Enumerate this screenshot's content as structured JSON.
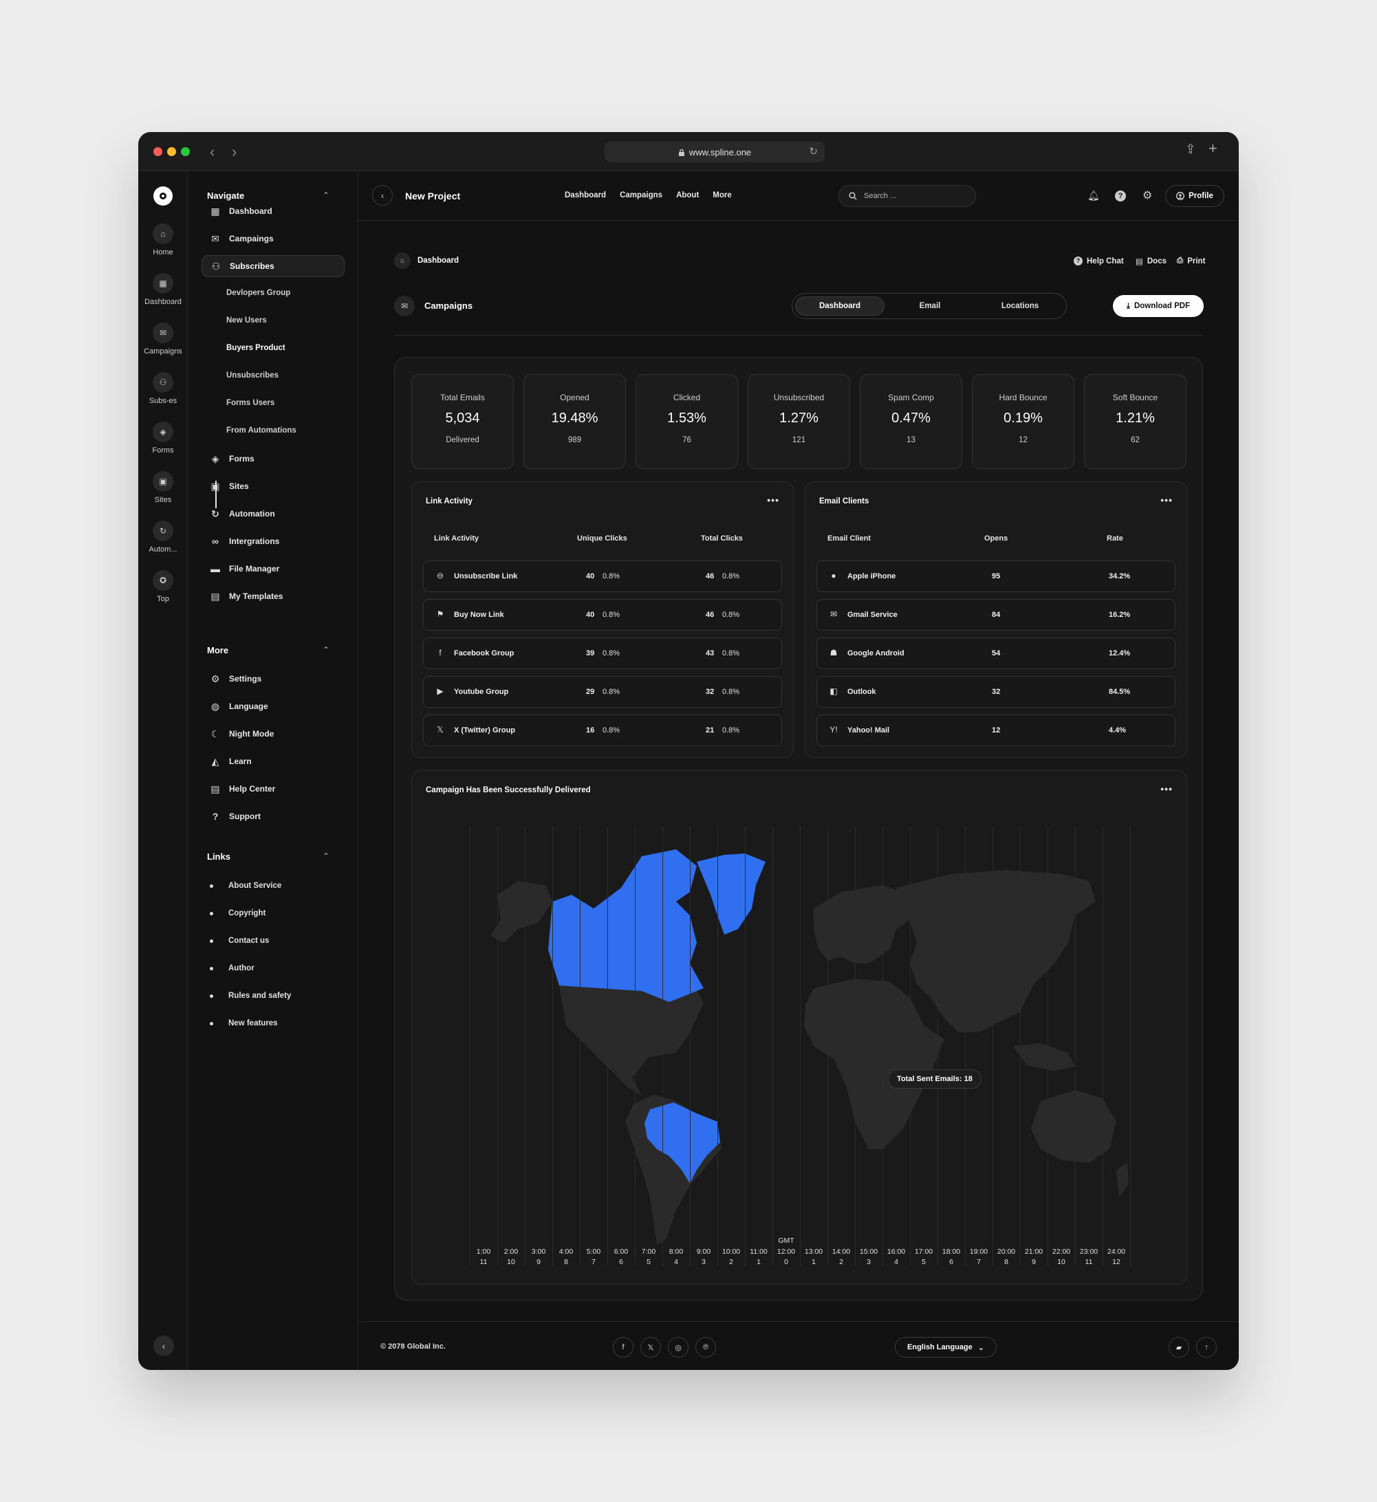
{
  "browser": {
    "url": "www.spline.one"
  },
  "rail": {
    "items": [
      {
        "label": "Home",
        "icon": "home-icon"
      },
      {
        "label": "Dashboard",
        "icon": "grid-icon"
      },
      {
        "label": "Campaigns",
        "icon": "mail-icon"
      },
      {
        "label": "Subs-es",
        "icon": "users-icon"
      },
      {
        "label": "Forms",
        "icon": "layers-icon"
      },
      {
        "label": "Sites",
        "icon": "window-icon"
      },
      {
        "label": "Autom...",
        "icon": "refresh-icon"
      },
      {
        "label": "Top",
        "icon": "star-icon"
      }
    ]
  },
  "sidebar": {
    "navigate_title": "Navigate",
    "nav": [
      "Dashboard",
      "Campaings",
      "Subscribes"
    ],
    "sub": [
      "Devlopers Group",
      "New Users",
      "Buyers Product",
      "Unsubscribes",
      "Forms Users",
      "From Automations"
    ],
    "nav2": [
      "Forms",
      "Sites",
      "Automation",
      "Intergrations",
      "File Manager",
      "My Templates"
    ],
    "more_title": "More",
    "more": [
      "Settings",
      "Language",
      "Night Mode",
      "Learn",
      "Help Center",
      "Support"
    ],
    "links_title": "Links",
    "links": [
      "About Service",
      "Copyright",
      "Contact us",
      "Author",
      "Rules and safety",
      "New features"
    ]
  },
  "header": {
    "title": "New Project",
    "nav": [
      "Dashboard",
      "Campaigns",
      "About",
      "More"
    ],
    "search_placeholder": "Search ...",
    "profile": "Profile"
  },
  "toolbar": {
    "breadcrumb": "Dashboard",
    "help_chat": "Help Chat",
    "docs": "Docs",
    "print": "Print",
    "section": "Campaigns",
    "tabs": [
      "Dashboard",
      "Email",
      "Locations"
    ],
    "download": "Download PDF"
  },
  "stats": [
    {
      "title": "Total Emails",
      "value": "5,034",
      "sub": "Delivered"
    },
    {
      "title": "Opened",
      "value": "19.48%",
      "sub": "989"
    },
    {
      "title": "Clicked",
      "value": "1.53%",
      "sub": "76"
    },
    {
      "title": "Unsubscribed",
      "value": "1.27%",
      "sub": "121"
    },
    {
      "title": "Spam Comp",
      "value": "0.47%",
      "sub": "13"
    },
    {
      "title": "Hard Bounce",
      "value": "0.19%",
      "sub": "12"
    },
    {
      "title": "Soft Bounce",
      "value": "1.21%",
      "sub": "62"
    }
  ],
  "link_activity": {
    "title": "Link Activity",
    "headers": [
      "Link Activity",
      "Unique Clicks",
      "Total Clicks"
    ],
    "rows": [
      {
        "name": "Unsubscribe Link",
        "uc": "40",
        "ucp": "0.8%",
        "tc": "46",
        "tcp": "0.8%"
      },
      {
        "name": "Buy Now Link",
        "uc": "40",
        "ucp": "0.8%",
        "tc": "46",
        "tcp": "0.8%"
      },
      {
        "name": "Facebook Group",
        "uc": "39",
        "ucp": "0.8%",
        "tc": "43",
        "tcp": "0.8%"
      },
      {
        "name": "Youtube Group",
        "uc": "29",
        "ucp": "0.8%",
        "tc": "32",
        "tcp": "0.8%"
      },
      {
        "name": "X (Twitter) Group",
        "uc": "16",
        "ucp": "0.8%",
        "tc": "21",
        "tcp": "0.8%"
      }
    ]
  },
  "email_clients": {
    "title": "Email Clients",
    "headers": [
      "Email Client",
      "Opens",
      "Rate"
    ],
    "rows": [
      {
        "name": "Apple iPhone",
        "opens": "95",
        "rate": "34.2%"
      },
      {
        "name": "Gmail Service",
        "opens": "84",
        "rate": "16.2%"
      },
      {
        "name": "Google Android",
        "opens": "54",
        "rate": "12.4%"
      },
      {
        "name": "Outlook",
        "opens": "32",
        "rate": "84.5%"
      },
      {
        "name": "Yahoo! Mail",
        "opens": "12",
        "rate": "4.4%"
      }
    ]
  },
  "map": {
    "title": "Campaign Has Been Successfully Delivered",
    "tooltip": "Total Sent Emails: 18",
    "gmt": "GMT",
    "times": [
      "1:00",
      "2:00",
      "3:00",
      "4:00",
      "5:00",
      "6:00",
      "7:00",
      "8:00",
      "9:00",
      "10:00",
      "11:00",
      "12:00",
      "13:00",
      "14:00",
      "15:00",
      "16:00",
      "17:00",
      "18:00",
      "19:00",
      "20:00",
      "21:00",
      "22:00",
      "23:00",
      "24:00"
    ],
    "offsets": [
      "11",
      "10",
      "9",
      "8",
      "7",
      "6",
      "5",
      "4",
      "3",
      "2",
      "1",
      "0",
      "1",
      "2",
      "3",
      "4",
      "5",
      "6",
      "7",
      "8",
      "9",
      "10",
      "11",
      "12"
    ],
    "highlight": "#2f6ff0",
    "land": "#2a2a2a"
  },
  "footer": {
    "copyright": "© 2078 Global Inc.",
    "language": "English Language"
  }
}
